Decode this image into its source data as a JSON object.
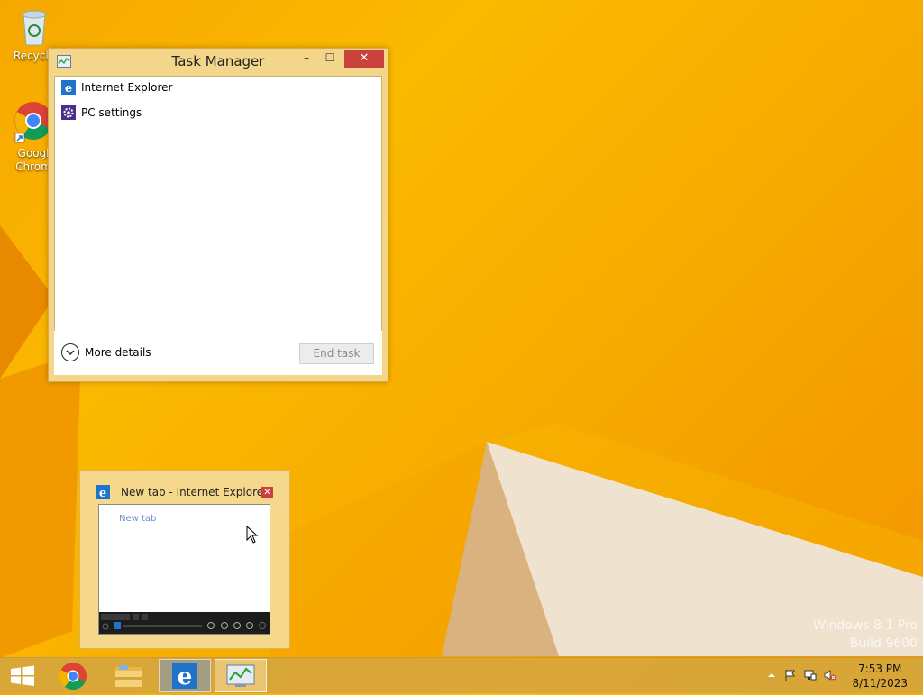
{
  "desktop": {
    "icons": [
      {
        "label": "Recycle",
        "icon": "recycle-bin-icon"
      },
      {
        "label": "Googl\nChrom",
        "icon": "chrome-icon"
      }
    ],
    "watermark": {
      "line1": "Windows 8.1 Pro",
      "line2": "Build 9600"
    }
  },
  "task_manager": {
    "title": "Task Manager",
    "processes": [
      {
        "name": "Internet Explorer",
        "icon": "ie-icon"
      },
      {
        "name": "PC settings",
        "icon": "gear-icon"
      }
    ],
    "more_details_label": "More details",
    "end_task_label": "End task",
    "minimize_label": "–",
    "maximize_label": "☐",
    "close_label": "✕"
  },
  "thumbnail": {
    "title": "New tab - Internet Explorer",
    "close_label": "✕",
    "content_text": "New tab"
  },
  "taskbar": {
    "apps": [
      {
        "name": "start",
        "icon": "windows-start-icon"
      },
      {
        "name": "chrome",
        "icon": "chrome-icon"
      },
      {
        "name": "file-explorer",
        "icon": "folder-icon"
      },
      {
        "name": "internet-explorer",
        "icon": "ie-icon"
      },
      {
        "name": "task-manager",
        "icon": "task-manager-icon"
      }
    ],
    "clock": {
      "time": "7:53 PM",
      "date": "8/11/2023"
    }
  },
  "colors": {
    "wallpaper": "#f6a800",
    "close_red": "#c9413a",
    "ie_blue": "#1f74c9"
  }
}
